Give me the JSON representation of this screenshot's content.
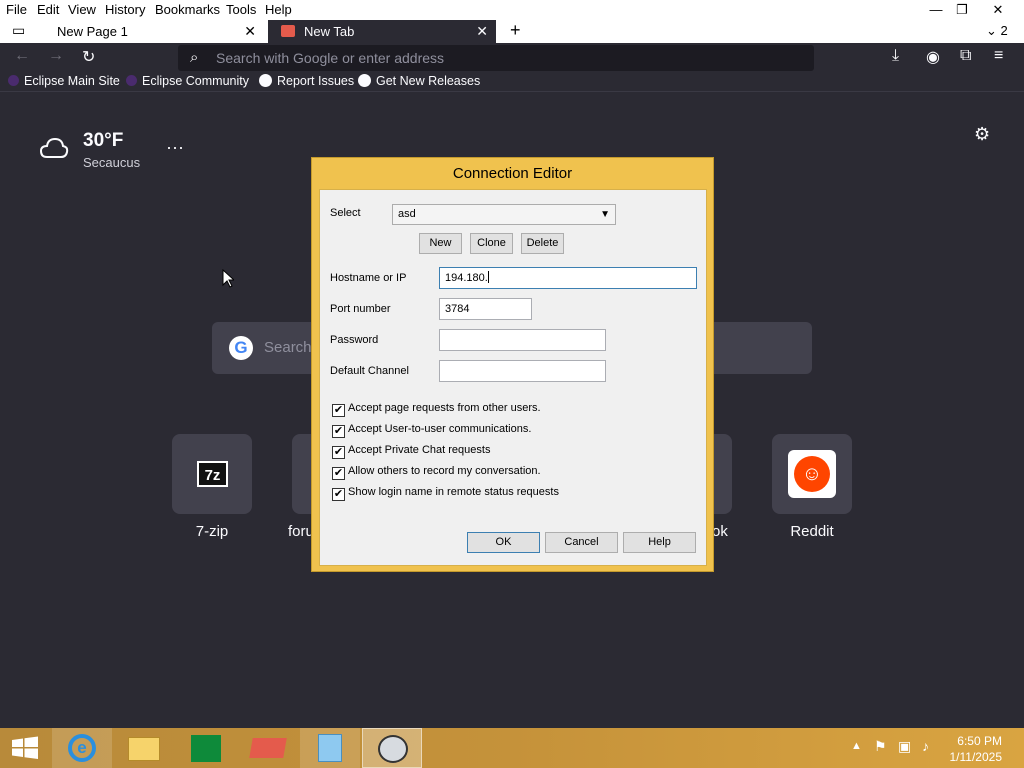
{
  "menubar": {
    "items": [
      "File",
      "Edit",
      "View",
      "History",
      "Bookmarks",
      "Tools",
      "Help"
    ]
  },
  "tabs": [
    {
      "label": "New Page 1"
    },
    {
      "label": "New Tab"
    }
  ],
  "tab_count": "2",
  "toolbar": {
    "url_placeholder": "Search with Google or enter address"
  },
  "bookmarks": [
    "Eclipse Main Site",
    "Eclipse Community",
    "Report Issues",
    "Get New Releases"
  ],
  "weather": {
    "temp": "30°F",
    "city": "Secaucus"
  },
  "ntp_search": {
    "placeholder": "Search"
  },
  "top_sites": [
    "7-zip",
    "foru",
    "ok",
    "Reddit"
  ],
  "dialog": {
    "title": "Connection Editor",
    "select_label": "Select",
    "select_value": "asd",
    "buttons": {
      "new": "New",
      "clone": "Clone",
      "delete": "Delete"
    },
    "hostname_label": "Hostname or IP",
    "hostname_value": "194.180.",
    "port_label": "Port number",
    "port_value": "3784",
    "password_label": "Password",
    "password_value": "",
    "channel_label": "Default Channel",
    "channel_value": "",
    "checkboxes": [
      {
        "label": "Accept page requests from other users.",
        "checked": true
      },
      {
        "label": "Accept User-to-user communications.",
        "checked": true
      },
      {
        "label": "Accept Private Chat requests",
        "checked": true
      },
      {
        "label": "Allow others to record my conversation.",
        "checked": true
      },
      {
        "label": "Show login name in remote status requests",
        "checked": true
      }
    ],
    "ok": "OK",
    "cancel": "Cancel",
    "help": "Help"
  },
  "taskbar": {
    "time": "6:50 PM",
    "date": "1/11/2025"
  },
  "colors": {
    "browser_bg": "#2b2a33",
    "dialog_frame": "#f0c24e",
    "taskbar": "#c5923a"
  }
}
